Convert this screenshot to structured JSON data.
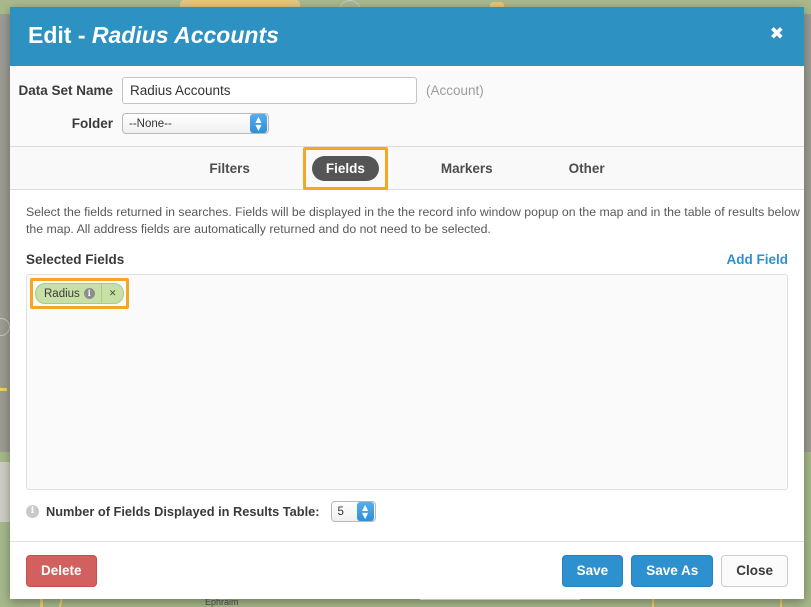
{
  "modal": {
    "title_prefix": "Edit - ",
    "title_name": "Radius Accounts",
    "close_icon": "close-icon",
    "header_color": "#2d91c2"
  },
  "meta": {
    "dataset_name_label": "Data Set Name",
    "dataset_name_value": "Radius Accounts",
    "dataset_name_placeholder": "Data Set Name",
    "object_type": "(Account)",
    "folder_label": "Folder",
    "folder_value": "--None--"
  },
  "tabs": [
    {
      "label": "Filters",
      "active": false,
      "highlighted": false
    },
    {
      "label": "Fields",
      "active": true,
      "highlighted": true
    },
    {
      "label": "Markers",
      "active": false,
      "highlighted": false
    },
    {
      "label": "Other",
      "active": false,
      "highlighted": false
    }
  ],
  "fields_panel": {
    "description": "Select the fields returned in searches. Fields will be displayed in the the record info window popup on the map and in the table of results below the map. All address fields are automatically returned and do not need to be selected.",
    "selected_fields_label": "Selected Fields",
    "add_field_label": "Add Field",
    "chips": [
      {
        "label": "Radius",
        "info_icon": "info-icon",
        "remove_icon": "remove-icon",
        "highlighted": true
      }
    ],
    "num_fields_label": "Number of Fields Displayed in Results Table:",
    "num_fields_value": "5",
    "num_fields_info_icon": "info-icon"
  },
  "footer": {
    "delete_label": "Delete",
    "save_label": "Save",
    "save_as_label": "Save As",
    "close_label": "Close"
  },
  "background_map": {
    "visible_label": "Ephraim"
  },
  "colors": {
    "accent_blue": "#2e91cf",
    "header_blue": "#2d91c2",
    "highlight_orange": "#f5a623",
    "chip_green": "#c7e0a6",
    "danger_red": "#d2605f",
    "active_tab_gray": "#555555"
  }
}
